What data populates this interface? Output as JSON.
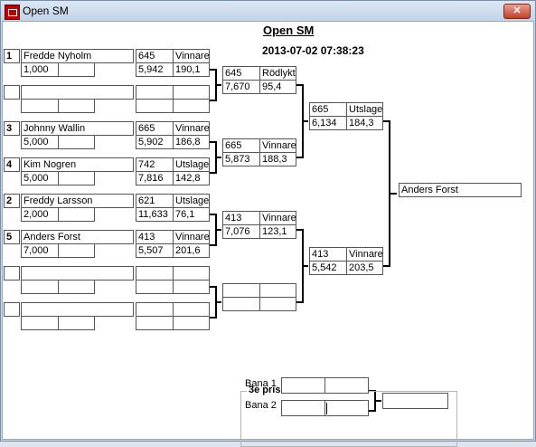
{
  "window": {
    "title": "Open SM",
    "close_label": "✕"
  },
  "header": {
    "title": "Open SM",
    "datetime": "2013-07-02 07:38:23"
  },
  "round1": [
    {
      "seed": "1",
      "name": "Fredde Nyholm",
      "score": "1,000",
      "extra": "",
      "lane": "645",
      "result": "Vinnare",
      "time": "5,942",
      "speed": "190,1"
    },
    {
      "seed": "",
      "name": "",
      "score": "",
      "extra": "",
      "lane": "",
      "result": "",
      "time": "",
      "speed": ""
    },
    {
      "seed": "3",
      "name": "Johnny Wallin",
      "score": "5,000",
      "extra": "",
      "lane": "665",
      "result": "Vinnare",
      "time": "5,902",
      "speed": "186,8"
    },
    {
      "seed": "4",
      "name": "Kim Nogren",
      "score": "5,000",
      "extra": "",
      "lane": "742",
      "result": "Utslagen",
      "time": "7,816",
      "speed": "142,8"
    },
    {
      "seed": "2",
      "name": "Freddy Larsson",
      "score": "2,000",
      "extra": "",
      "lane": "621",
      "result": "Utslagen",
      "time": "11,633",
      "speed": "76,1"
    },
    {
      "seed": "5",
      "name": "Anders Forst",
      "score": "7,000",
      "extra": "",
      "lane": "413",
      "result": "Vinnare",
      "time": "5,507",
      "speed": "201,6"
    },
    {
      "seed": "",
      "name": "",
      "score": "",
      "extra": "",
      "lane": "",
      "result": "",
      "time": "",
      "speed": ""
    },
    {
      "seed": "",
      "name": "",
      "score": "",
      "extra": "",
      "lane": "",
      "result": "",
      "time": "",
      "speed": ""
    }
  ],
  "round2": [
    {
      "lane": "645",
      "result": "Rödlykta",
      "time": "7,670",
      "speed": "95,4"
    },
    {
      "lane": "665",
      "result": "Vinnare",
      "time": "5,873",
      "speed": "188,3"
    },
    {
      "lane": "413",
      "result": "Vinnare",
      "time": "7,076",
      "speed": "123,1"
    },
    {
      "lane": "",
      "result": "",
      "time": "",
      "speed": ""
    }
  ],
  "round3": [
    {
      "lane": "665",
      "result": "Utslagen",
      "time": "6,134",
      "speed": "184,3"
    },
    {
      "lane": "413",
      "result": "Vinnare",
      "time": "5,542",
      "speed": "203,5"
    }
  ],
  "winner": {
    "name": "Anders Forst"
  },
  "third_place": {
    "title": "3e pris",
    "lane1_label": "Bana 1",
    "lane2_label": "Bana 2",
    "lane1_a": "",
    "lane1_b": "",
    "lane2_a": "",
    "lane2_b": "",
    "result": ""
  }
}
